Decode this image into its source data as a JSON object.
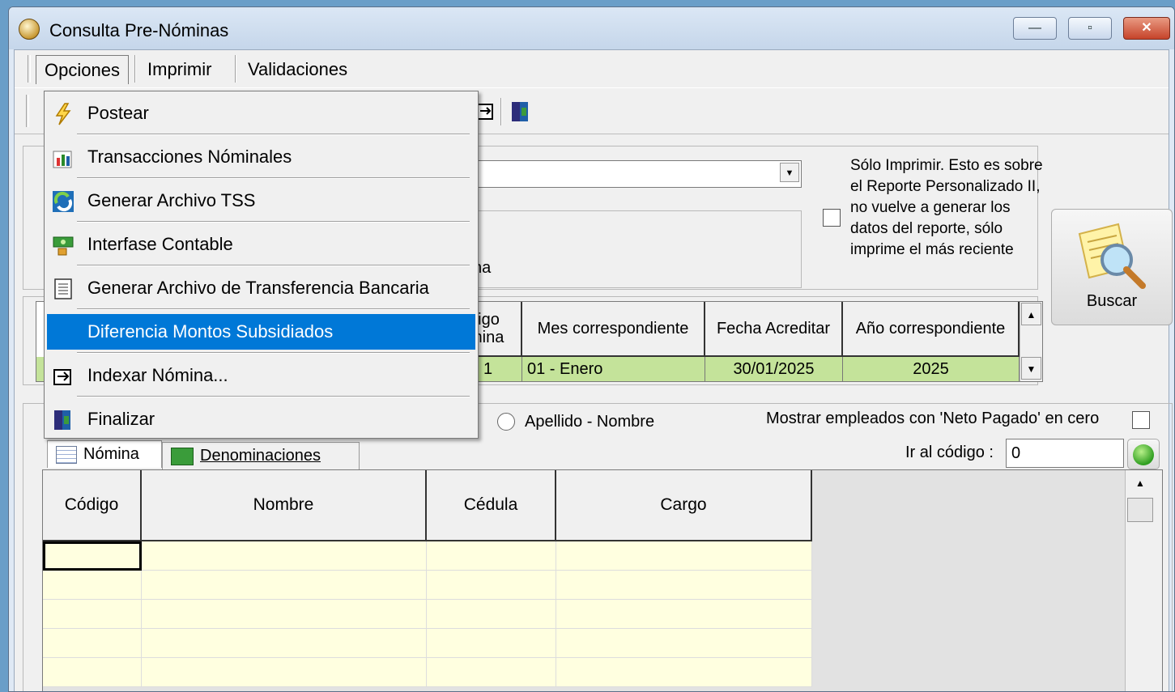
{
  "window": {
    "title": "Consulta Pre-Nóminas",
    "min_glyph": "—",
    "max_glyph": "▫",
    "close_glyph": "✕"
  },
  "menubar": [
    {
      "label": "Opciones"
    },
    {
      "label": "Imprimir"
    },
    {
      "label": "Validaciones"
    }
  ],
  "dropdown": {
    "items": [
      {
        "label": "Postear",
        "icon": "lightning-icon"
      },
      {
        "label": "Transacciones Nóminales",
        "icon": "chart-icon"
      },
      {
        "label": "Generar Archivo TSS",
        "icon": "refresh-icon"
      },
      {
        "label": "Interfase Contable",
        "icon": "money-icon"
      },
      {
        "label": "Generar Archivo de Transferencia Bancaria",
        "icon": "document-icon"
      },
      {
        "label": "Diferencia Montos Subsidiados",
        "icon": "",
        "highlighted": true
      },
      {
        "label": "Indexar Nómina...",
        "icon": "index-icon"
      },
      {
        "label": "Finalizar",
        "icon": "exit-door-icon"
      }
    ]
  },
  "filters": {
    "partial_label": "na",
    "solo_imprimir_note": "Sólo Imprimir. Esto es sobre el Reporte Personalizado II, no vuelve a generar los datos del reporte, sólo imprime el más reciente",
    "solo_imprimir_checked": false,
    "buscar_label": "Buscar"
  },
  "nomina_grid": {
    "header_partial": [
      "digo",
      "mina"
    ],
    "columns": [
      "Mes correspondiente",
      "Fecha Acreditar",
      "Año correspondiente"
    ],
    "row": {
      "codigo": "1",
      "mes": "01 - Enero",
      "fecha": "30/01/2025",
      "anio": "2025"
    }
  },
  "order": {
    "apellido_nombre_label": "Apellido - Nombre"
  },
  "options": {
    "mostrar_neto_cero_label": "Mostrar empleados con 'Neto Pagado' en cero",
    "mostrar_neto_cero_checked": false,
    "ir_codigo_label": "Ir al código :",
    "ir_codigo_value": "0"
  },
  "tabs": [
    {
      "label": "Nómina"
    },
    {
      "label": "Denominaciones"
    }
  ],
  "employees_grid": {
    "columns": [
      "Código",
      "Nombre",
      "Cédula",
      "Cargo"
    ],
    "rows": 5
  },
  "colors": {
    "highlight": "#0078d7",
    "selected_row": "#c4e39a",
    "grid_cell": "#ffffe0"
  }
}
